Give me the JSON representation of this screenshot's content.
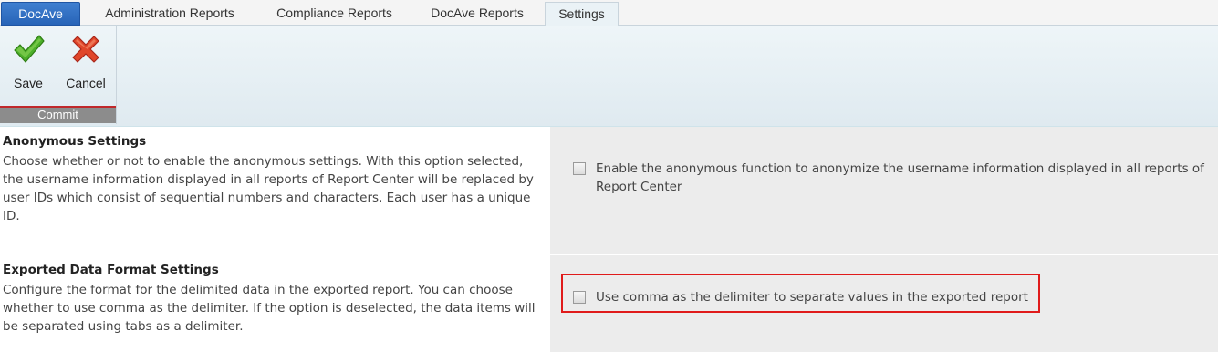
{
  "tabs": {
    "brand": "DocAve",
    "administration": "Administration Reports",
    "compliance": "Compliance Reports",
    "docave_reports": "DocAve Reports",
    "settings": "Settings"
  },
  "ribbon": {
    "save_label": "Save",
    "cancel_label": "Cancel",
    "group_label": "Commit"
  },
  "anonymous": {
    "title": "Anonymous Settings",
    "description": "Choose whether or not to enable the anonymous settings. With this option selected, the username information displayed in all reports of Report Center will be replaced by user IDs which consist of sequential numbers and characters. Each user has a unique ID.",
    "option_label": "Enable the anonymous function to anonymize the username information displayed in all reports of Report Center",
    "checked": false
  },
  "export_format": {
    "title": "Exported Data Format Settings",
    "description": "Configure the format for the delimited data in the exported report. You can choose whether to use comma as the delimiter. If the option is deselected, the data items will be separated using tabs as a delimiter.",
    "option_label": "Use comma as the delimiter to separate values in the exported report",
    "checked": false
  },
  "colors": {
    "brand_tab": "#2864b8",
    "highlight_border": "#e01b1b",
    "commit_bar": "#8c8c8c"
  }
}
